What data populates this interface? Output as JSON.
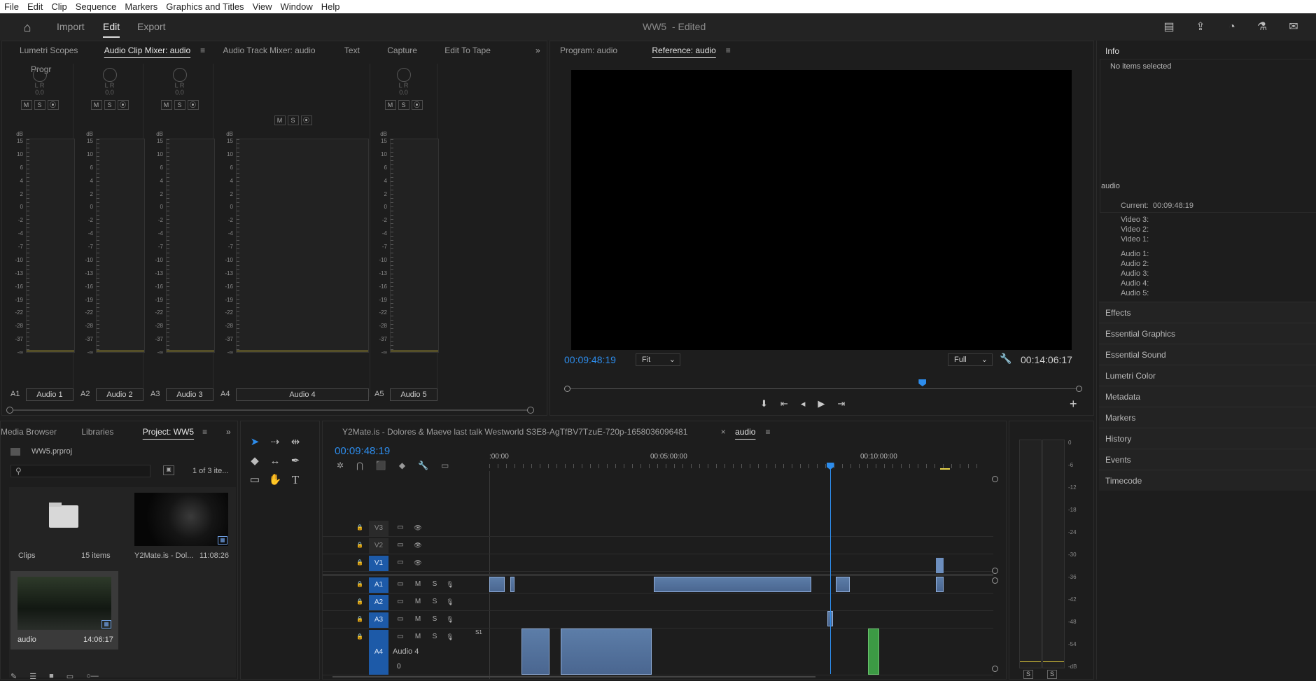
{
  "menu": [
    "File",
    "Edit",
    "Clip",
    "Sequence",
    "Markers",
    "Graphics and Titles",
    "View",
    "Window",
    "Help"
  ],
  "header": {
    "nav": [
      "Import",
      "Edit",
      "Export"
    ],
    "title": "WW5",
    "title_suffix": "- Edited"
  },
  "source_panel": {
    "tabs": [
      "Lumetri Scopes",
      "Audio Clip Mixer: audio",
      "Audio Track Mixer: audio",
      "Text",
      "Capture",
      "Edit To Tape",
      "Progr"
    ],
    "channels": [
      {
        "id": "A1",
        "name": "Audio 1",
        "knob_value": "0.0"
      },
      {
        "id": "A2",
        "name": "Audio 2",
        "knob_value": "0.0"
      },
      {
        "id": "A3",
        "name": "Audio 3",
        "knob_value": "0.0"
      },
      {
        "id": "A4",
        "name": "Audio 4",
        "knob_value": ""
      },
      {
        "id": "A5",
        "name": "Audio 5",
        "knob_value": "0.0"
      }
    ],
    "scale": [
      "dB",
      "15",
      "10",
      "6",
      "4",
      "2",
      "0",
      "-2",
      "-4",
      "-7",
      "-10",
      "-13",
      "-16",
      "-19",
      "-22",
      "-28",
      "-37",
      "-∞"
    ],
    "lr": "L R",
    "m": "M",
    "s": "S",
    "r": "⦿"
  },
  "program_panel": {
    "tabs": [
      "Program: audio",
      "Reference: audio"
    ],
    "timecode_left": "00:09:48:19",
    "fit": "Fit",
    "full": "Full",
    "timecode_right": "00:14:06:17",
    "playhead_fraction": 0.691
  },
  "info_panel": {
    "title": "Info",
    "no_items": "No items selected",
    "section": "audio",
    "current_label": "Current:",
    "current_value": "00:09:48:19",
    "video": [
      "Video 3:",
      "Video 2:",
      "Video 1:"
    ],
    "audio": [
      "Audio 1:",
      "Audio 2:",
      "Audio 3:",
      "Audio 4:",
      "Audio 5:"
    ]
  },
  "side_panels": [
    "Effects",
    "Essential Graphics",
    "Essential Sound",
    "Lumetri Color",
    "Metadata",
    "Markers",
    "History",
    "Events",
    "Timecode"
  ],
  "project_panel": {
    "tabs": [
      "Media Browser",
      "Libraries",
      "Project: WW5"
    ],
    "file": "WW5.prproj",
    "count": "1 of 3 ite...",
    "items": [
      {
        "name": "Clips",
        "meta": "15 items"
      },
      {
        "name": "Y2Mate.is - Dol...",
        "meta": "11:08:26"
      },
      {
        "name": "audio",
        "meta": "14:06:17"
      }
    ]
  },
  "timeline": {
    "tabs": [
      "Y2Mate.is - Dolores & Maeve last talk Westworld S3E8-AgTfBV7TzuE-720p-1658036096481",
      "audio"
    ],
    "timecode": "00:09:48:19",
    "ruler": [
      ":00:00",
      "00:05:00:00",
      "00:10:00:00"
    ],
    "tracks": [
      {
        "id": "V3",
        "label": "V3"
      },
      {
        "id": "V2",
        "label": "V2"
      },
      {
        "id": "V1",
        "label": "V1"
      },
      {
        "id": "A1",
        "label": "A1"
      },
      {
        "id": "A2",
        "label": "A2"
      },
      {
        "id": "A3",
        "label": "A3"
      },
      {
        "id": "A4",
        "label": "A4",
        "name": "Audio 4",
        "vol": "0",
        "marker": "S1"
      }
    ],
    "playhead_fraction": 0.695
  },
  "audio_meter": {
    "scale": [
      "0",
      "-6",
      "-12",
      "-18",
      "-24",
      "-30",
      "-36",
      "-42",
      "-48",
      "-54",
      "-dB"
    ],
    "solo": [
      "S",
      "S"
    ]
  },
  "colors": {
    "accent": "#2d8ceb",
    "track_on": "#1d5aa8",
    "clip_video": "#6d8fbf",
    "clip_audio": "#5c7da8",
    "clip_green": "#3c9a44"
  }
}
